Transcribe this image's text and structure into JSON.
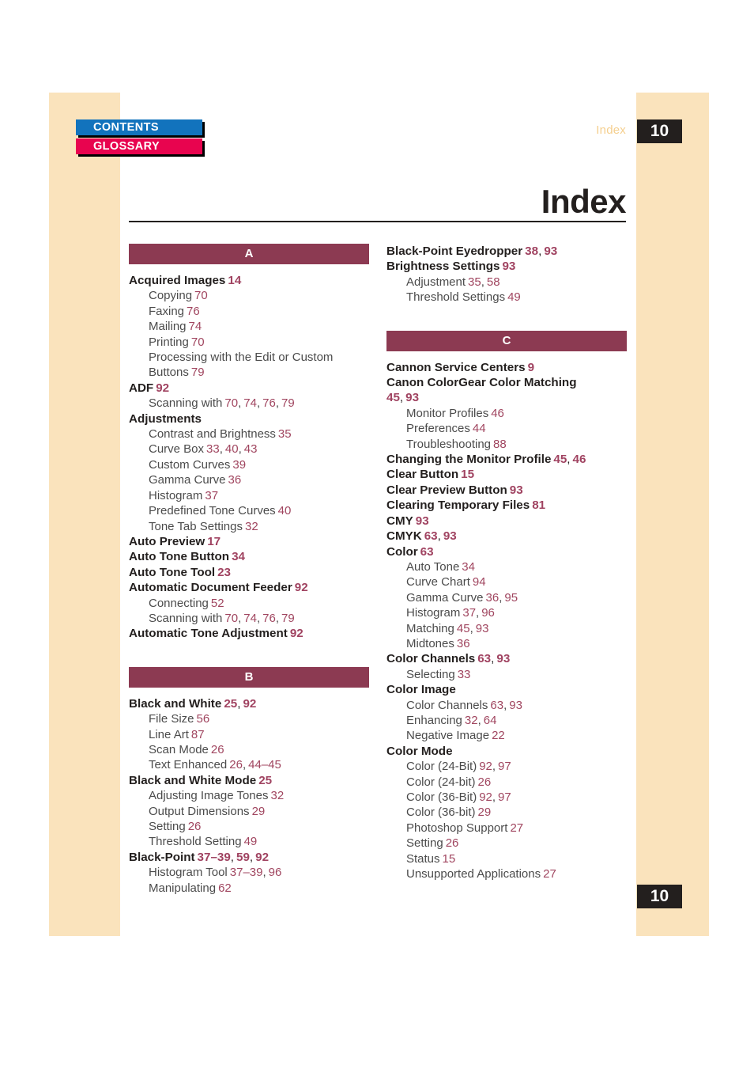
{
  "nav": {
    "contents_label": "CONTENTS",
    "glossary_label": "GLOSSARY"
  },
  "header": {
    "running_head": "Index",
    "chapter_number": "10"
  },
  "title": "Index",
  "footer": {
    "chapter_number": "10"
  },
  "columns": [
    {
      "id": "left",
      "sections": [
        {
          "letter": "A",
          "entries": [
            {
              "level": "main",
              "text": "Acquired Images",
              "pages": [
                "14"
              ]
            },
            {
              "level": "sub",
              "text": "Copying",
              "pages": [
                "70"
              ]
            },
            {
              "level": "sub",
              "text": "Faxing",
              "pages": [
                "76"
              ]
            },
            {
              "level": "sub",
              "text": "Mailing",
              "pages": [
                "74"
              ]
            },
            {
              "level": "sub",
              "text": "Printing",
              "pages": [
                "70"
              ]
            },
            {
              "level": "sub",
              "text": "Processing with the Edit or Custom",
              "continuation": "Buttons",
              "pages": [
                "79"
              ]
            },
            {
              "level": "main",
              "text": "ADF",
              "pages": [
                "92"
              ]
            },
            {
              "level": "sub",
              "text": "Scanning with",
              "pages": [
                "70",
                "74",
                "76",
                "79"
              ]
            },
            {
              "level": "main",
              "text": "Adjustments",
              "pages": []
            },
            {
              "level": "sub",
              "text": "Contrast and Brightness",
              "pages": [
                "35"
              ]
            },
            {
              "level": "sub",
              "text": "Curve Box",
              "pages": [
                "33",
                "40",
                "43"
              ]
            },
            {
              "level": "sub",
              "text": "Custom Curves",
              "pages": [
                "39"
              ]
            },
            {
              "level": "sub",
              "text": "Gamma Curve",
              "pages": [
                "36"
              ]
            },
            {
              "level": "sub",
              "text": "Histogram",
              "pages": [
                "37"
              ]
            },
            {
              "level": "sub",
              "text": "Predefined Tone Curves",
              "pages": [
                "40"
              ]
            },
            {
              "level": "sub",
              "text": "Tone Tab Settings",
              "pages": [
                "32"
              ]
            },
            {
              "level": "main",
              "text": "Auto Preview",
              "pages": [
                "17"
              ]
            },
            {
              "level": "main",
              "text": "Auto Tone Button",
              "pages": [
                "34"
              ]
            },
            {
              "level": "main",
              "text": "Auto Tone Tool",
              "pages": [
                "23"
              ]
            },
            {
              "level": "main",
              "text": "Automatic Document Feeder",
              "pages": [
                "92"
              ]
            },
            {
              "level": "sub",
              "text": "Connecting",
              "pages": [
                "52"
              ]
            },
            {
              "level": "sub",
              "text": "Scanning with",
              "pages": [
                "70",
                "74",
                "76",
                "79"
              ]
            },
            {
              "level": "main",
              "text": "Automatic Tone Adjustment",
              "pages": [
                "92"
              ]
            }
          ]
        },
        {
          "letter": "B",
          "entries": [
            {
              "level": "main",
              "text": "Black and White",
              "pages": [
                "25",
                "92"
              ]
            },
            {
              "level": "sub",
              "text": "File Size",
              "pages": [
                "56"
              ]
            },
            {
              "level": "sub",
              "text": "Line Art",
              "pages": [
                "87"
              ]
            },
            {
              "level": "sub",
              "text": "Scan Mode",
              "pages": [
                "26"
              ]
            },
            {
              "level": "sub",
              "text": "Text Enhanced",
              "pages": [
                "26",
                "44–45"
              ]
            },
            {
              "level": "main",
              "text": "Black and White Mode",
              "pages": [
                "25"
              ]
            },
            {
              "level": "sub",
              "text": "Adjusting Image Tones",
              "pages": [
                "32"
              ]
            },
            {
              "level": "sub",
              "text": "Output Dimensions",
              "pages": [
                "29"
              ]
            },
            {
              "level": "sub",
              "text": "Setting",
              "pages": [
                "26"
              ]
            },
            {
              "level": "sub",
              "text": "Threshold Setting",
              "pages": [
                "49"
              ]
            },
            {
              "level": "main",
              "text": "Black-Point",
              "pages": [
                "37–39",
                "59",
                "92"
              ]
            },
            {
              "level": "sub",
              "text": "Histogram Tool",
              "pages": [
                "37–39",
                "96"
              ]
            },
            {
              "level": "sub",
              "text": "Manipulating",
              "pages": [
                "62"
              ]
            }
          ]
        }
      ]
    },
    {
      "id": "right",
      "sections": [
        {
          "letter": null,
          "entries": [
            {
              "level": "main",
              "text": "Black-Point Eyedropper",
              "pages": [
                "38",
                "93"
              ]
            },
            {
              "level": "main",
              "text": "Brightness Settings",
              "pages": [
                "93"
              ]
            },
            {
              "level": "sub",
              "text": "Adjustment",
              "pages": [
                "35",
                "58"
              ]
            },
            {
              "level": "sub",
              "text": "Threshold Settings",
              "pages": [
                "49"
              ]
            }
          ]
        },
        {
          "letter": "C",
          "entries": [
            {
              "level": "main",
              "text": "Cannon Service Centers",
              "pages": [
                "9"
              ]
            },
            {
              "level": "main",
              "text": "Canon ColorGear Color Matching",
              "pages_on_new_line": true,
              "pages": [
                "45",
                "93"
              ]
            },
            {
              "level": "sub",
              "text": "Monitor Profiles",
              "pages": [
                "46"
              ]
            },
            {
              "level": "sub",
              "text": "Preferences",
              "pages": [
                "44"
              ]
            },
            {
              "level": "sub",
              "text": "Troubleshooting",
              "pages": [
                "88"
              ]
            },
            {
              "level": "main",
              "text": "Changing the Monitor Profile",
              "pages": [
                "45",
                "46"
              ]
            },
            {
              "level": "main",
              "text": "Clear Button",
              "pages": [
                "15"
              ]
            },
            {
              "level": "main",
              "text": "Clear Preview Button",
              "pages": [
                "93"
              ]
            },
            {
              "level": "main",
              "text": "Clearing Temporary Files",
              "pages": [
                "81"
              ]
            },
            {
              "level": "main",
              "text": "CMY",
              "pages": [
                "93"
              ]
            },
            {
              "level": "main",
              "text": "CMYK",
              "pages": [
                "63",
                "93"
              ]
            },
            {
              "level": "main",
              "text": "Color",
              "pages": [
                "63"
              ]
            },
            {
              "level": "sub",
              "text": "Auto Tone",
              "pages": [
                "34"
              ]
            },
            {
              "level": "sub",
              "text": "Curve Chart",
              "pages": [
                "94"
              ]
            },
            {
              "level": "sub",
              "text": "Gamma Curve",
              "pages": [
                "36",
                "95"
              ]
            },
            {
              "level": "sub",
              "text": "Histogram",
              "pages": [
                "37",
                "96"
              ]
            },
            {
              "level": "sub",
              "text": "Matching",
              "pages": [
                "45",
                "93"
              ]
            },
            {
              "level": "sub",
              "text": "Midtones",
              "pages": [
                "36"
              ]
            },
            {
              "level": "main",
              "text": "Color Channels",
              "pages": [
                "63",
                "93"
              ]
            },
            {
              "level": "sub",
              "text": "Selecting",
              "pages": [
                "33"
              ]
            },
            {
              "level": "main",
              "text": "Color Image",
              "pages": []
            },
            {
              "level": "sub",
              "text": "Color Channels",
              "pages": [
                "63",
                "93"
              ]
            },
            {
              "level": "sub",
              "text": "Enhancing",
              "pages": [
                "32",
                "64"
              ]
            },
            {
              "level": "sub",
              "text": "Negative Image",
              "pages": [
                "22"
              ]
            },
            {
              "level": "main",
              "text": "Color Mode",
              "pages": []
            },
            {
              "level": "sub",
              "text": "Color (24-Bit)",
              "pages": [
                "92",
                "97"
              ]
            },
            {
              "level": "sub",
              "text": "Color (24-bit)",
              "pages": [
                "26"
              ]
            },
            {
              "level": "sub",
              "text": "Color (36-Bit)",
              "pages": [
                "92",
                "97"
              ]
            },
            {
              "level": "sub",
              "text": "Color (36-bit)",
              "pages": [
                "29"
              ]
            },
            {
              "level": "sub",
              "text": "Photoshop Support",
              "pages": [
                "27"
              ]
            },
            {
              "level": "sub",
              "text": "Setting",
              "pages": [
                "26"
              ]
            },
            {
              "level": "sub",
              "text": "Status",
              "pages": [
                "15"
              ]
            },
            {
              "level": "sub",
              "text": "Unsupported Applications",
              "pages": [
                "27"
              ]
            }
          ]
        }
      ]
    }
  ],
  "colors": {
    "band": "#fae3bc",
    "letter_bar": "#8c3a52",
    "page_number": "#a04361",
    "contents_button": "#1273bd",
    "glossary_button": "#e8044f",
    "chapter_tab": "#231f1e"
  }
}
